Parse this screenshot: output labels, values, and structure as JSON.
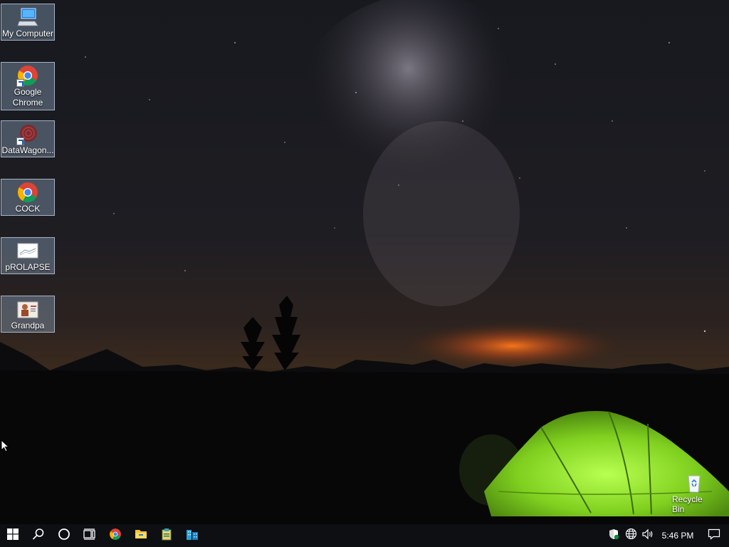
{
  "desktop": {
    "icons": [
      {
        "label": "My Computer",
        "icon": "my-computer-icon"
      },
      {
        "label": "Google Chrome",
        "icon": "google-chrome-icon"
      },
      {
        "label": "DataWagon...",
        "icon": "datawagon-icon"
      },
      {
        "label": "COCK",
        "icon": "chrome-shortcut-icon"
      },
      {
        "label": "pROLAPSE",
        "icon": "image-file-icon"
      },
      {
        "label": "Grandpa",
        "icon": "image-file-icon"
      }
    ],
    "recycle_bin": {
      "label": "Recycle Bin",
      "icon": "recycle-bin-icon"
    }
  },
  "taskbar": {
    "pinned": [
      "start-icon",
      "search-icon",
      "cortana-icon",
      "task-view-icon",
      "chrome-icon",
      "file-explorer-icon",
      "app-icon",
      "building-app-icon"
    ],
    "tray": [
      "security-shield-icon",
      "network-globe-icon",
      "volume-icon"
    ],
    "clock": "5:46 PM",
    "notification": "action-center-icon"
  },
  "colors": {
    "taskbar": "#0d0f13",
    "icon_highlight": "#96afcd",
    "tent": "#8fe030"
  }
}
